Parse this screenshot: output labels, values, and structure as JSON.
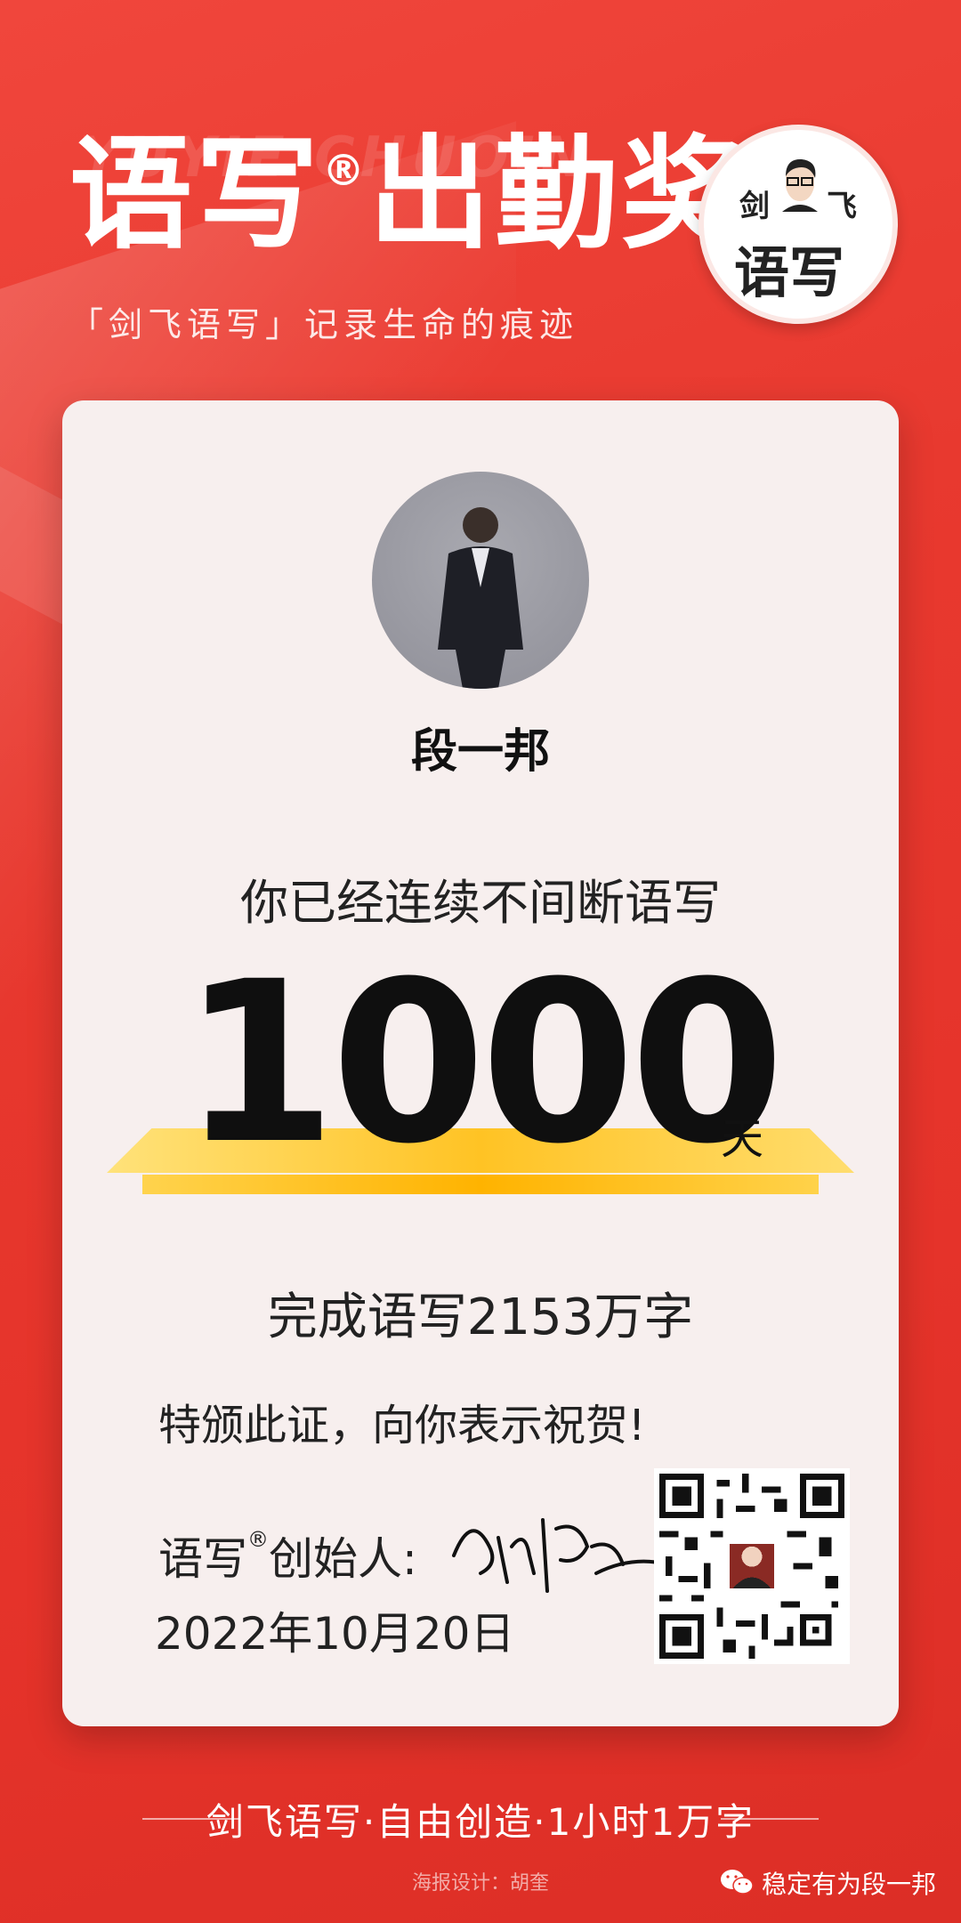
{
  "header": {
    "watermark": "YUYIE CHUOIN",
    "title_a": "语写",
    "title_reg": "®",
    "title_b": "出勤奖",
    "subtitle": "「剑飞语写」记录生命的痕迹"
  },
  "logo": {
    "top_left": "剑",
    "top_right": "飞",
    "bottom": "语写"
  },
  "card": {
    "name": "段一邦",
    "line1": "你已经连续不间断语写",
    "days": "1000",
    "unit": "天",
    "total": "完成语写2153万字",
    "congrats": "特颁此证，向你表示祝贺!",
    "founder_a": "语写",
    "founder_reg": "®",
    "founder_b": "创始人:",
    "date": "2022年10月20日"
  },
  "footer": {
    "slogan": "剑飞语写·自由创造·1小时1万字",
    "credit": "海报设计：胡奎",
    "wechat": "稳定有为段一邦"
  },
  "colors": {
    "bg": "#e8392f",
    "gold": "#ffc324",
    "card": "#f7efee"
  }
}
